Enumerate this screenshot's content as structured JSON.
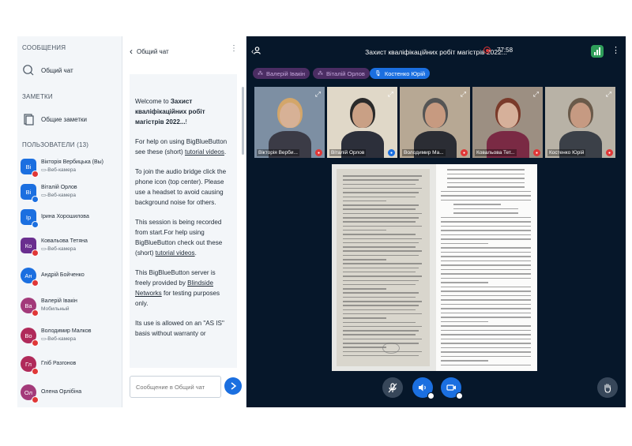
{
  "sidebar": {
    "messages_title": "СООБЩЕНИЯ",
    "public_chat": "Общий чат",
    "notes_title": "ЗАМЕТКИ",
    "shared_notes": "Общие заметки",
    "users_title": "ПОЛЬЗОВАТЕЛИ (13)",
    "users": [
      {
        "initials": "Ві",
        "name": "Вікторія Вербицька (Вы)",
        "sub": "▭-Веб-камера",
        "color": "#1b6fe0",
        "shape": "square",
        "badge": "#e03737"
      },
      {
        "initials": "Ві",
        "name": "Віталій Орлов",
        "sub": "▭-Веб-камера",
        "color": "#1b6fe0",
        "shape": "square",
        "badge": "#1b6fe0"
      },
      {
        "initials": "Ір",
        "name": "Ірина Хорошилова",
        "sub": "",
        "color": "#1b6fe0",
        "shape": "square",
        "badge": "#1b6fe0"
      },
      {
        "initials": "Ко",
        "name": "Ковальова Тетяна",
        "sub": "▭-Веб-камера",
        "color": "#6a2e8f",
        "shape": "square",
        "badge": "#e03737"
      },
      {
        "initials": "Ан",
        "name": "Андрій Бойченко",
        "sub": "",
        "color": "#1b6fe0",
        "shape": "round",
        "badge": "#e03737"
      },
      {
        "initials": "Ва",
        "name": "Валерій Івакін",
        "sub": "Мобильный",
        "color": "#a33a7a",
        "shape": "round",
        "badge": "#e03737"
      },
      {
        "initials": "Во",
        "name": "Володимир Малков",
        "sub": "▭-Веб-камера",
        "color": "#b02a5a",
        "shape": "round",
        "badge": "#e03737"
      },
      {
        "initials": "Гл",
        "name": "Гліб Разгонов",
        "sub": "",
        "color": "#b02a5a",
        "shape": "round",
        "badge": "#e03737"
      },
      {
        "initials": "Ол",
        "name": "Олена Орлібіна",
        "sub": "",
        "color": "#a33a7a",
        "shape": "round",
        "badge": "#e03737"
      }
    ]
  },
  "chat": {
    "title": "Общий чат",
    "welcome_prefix": "Welcome to ",
    "welcome_bold": "Захист кваліфікаційних робіт магістрів 2022...",
    "welcome_suffix": "!",
    "help_text": "For help on using BigBlueButton see these (short) ",
    "help_link": "tutorial videos",
    "help_end": ".",
    "audio_text": "To join the audio bridge click the phone icon (top center). Please use a headset to avoid causing background noise for others.",
    "rec_text": "This session is being recorded from start.For help using BigBlueButton check out these (short) ",
    "rec_link": "tutorial videos",
    "rec_end": ".",
    "server_text": "This BigBlueButton server is freely provided by ",
    "server_link": "Blindside Networks",
    "server_end": " for testing purposes only.",
    "use_text": "Its use is allowed on an \"AS IS\" basis without warranty or",
    "input_placeholder": "Сообщение в Общий чат"
  },
  "main": {
    "title": "Захист кваліфікаційних робіт магістрів 2022...",
    "rec_time": "77:58",
    "talkers": [
      {
        "name": "Валерій Івакін",
        "active": false
      },
      {
        "name": "Віталій Орлов",
        "active": false
      },
      {
        "name": "Костенко Юрій",
        "active": true
      }
    ],
    "tiles": [
      {
        "name": "Вікторія Верби...",
        "mic": "muted",
        "bg": "#7d8fa3",
        "skin": "#d7b196",
        "hair": "#d3a66a",
        "cloth": "#3b3b46"
      },
      {
        "name": "Віталій Орлов",
        "mic": "on",
        "bg": "#e0d8c8",
        "skin": "#c9a085",
        "hair": "#2a2a2a",
        "cloth": "#2c2f3a"
      },
      {
        "name": "Володимир Ма...",
        "mic": "muted",
        "bg": "#b7a894",
        "skin": "#c79a80",
        "hair": "#555555",
        "cloth": "#2b2d34"
      },
      {
        "name": "Ковальова Тет...",
        "mic": "muted",
        "bg": "#9c8f82",
        "skin": "#d6b09a",
        "hair": "#7a3a2a",
        "cloth": "#7a2a44"
      },
      {
        "name": "Костенко Юрій",
        "mic": "muted",
        "bg": "#b8b2a6",
        "skin": "#c69a82",
        "hair": "#6a5a4a",
        "cloth": "#3b4048"
      }
    ]
  },
  "icons": {
    "users_toggle": "users-icon",
    "record": "record-icon",
    "connection": "connection-icon"
  }
}
